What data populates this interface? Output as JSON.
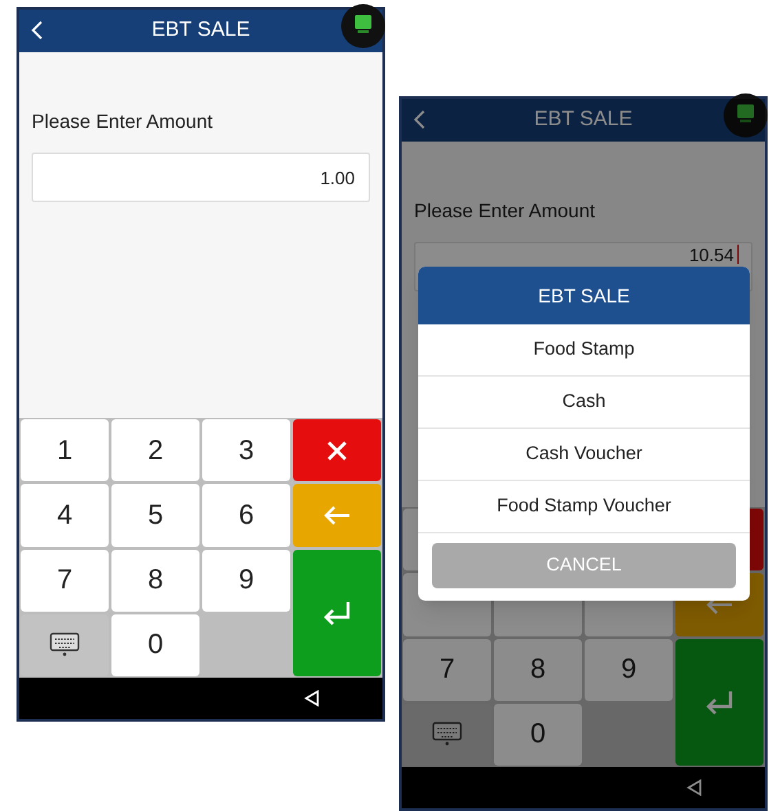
{
  "phones": [
    {
      "header": {
        "title": "EBT SALE"
      },
      "prompt": "Please Enter Amount",
      "amount": "1.00",
      "cursor": false,
      "dimmed": false,
      "keypad": [
        {
          "kind": "digit",
          "label": "1"
        },
        {
          "kind": "digit",
          "label": "2"
        },
        {
          "kind": "digit",
          "label": "3"
        },
        {
          "kind": "clear"
        },
        {
          "kind": "digit",
          "label": "4"
        },
        {
          "kind": "digit",
          "label": "5"
        },
        {
          "kind": "digit",
          "label": "6"
        },
        {
          "kind": "backspace"
        },
        {
          "kind": "digit",
          "label": "7"
        },
        {
          "kind": "digit",
          "label": "8"
        },
        {
          "kind": "digit",
          "label": "9"
        },
        {
          "kind": "enter"
        },
        {
          "kind": "keyboard"
        },
        {
          "kind": "digit",
          "label": "0"
        }
      ]
    },
    {
      "header": {
        "title": "EBT SALE"
      },
      "prompt": "Please Enter Amount",
      "amount": "10.54",
      "cursor": true,
      "dimmed": true,
      "keypad": [
        {
          "kind": "covered"
        },
        {
          "kind": "hidden"
        },
        {
          "kind": "hidden"
        },
        {
          "kind": "covered-clear"
        },
        {
          "kind": "covered"
        },
        {
          "kind": "covered"
        },
        {
          "kind": "covered"
        },
        {
          "kind": "backspace"
        },
        {
          "kind": "digit",
          "label": "7"
        },
        {
          "kind": "digit",
          "label": "8"
        },
        {
          "kind": "digit",
          "label": "9"
        },
        {
          "kind": "enter"
        },
        {
          "kind": "keyboard"
        },
        {
          "kind": "digit",
          "label": "0"
        }
      ],
      "dialog": {
        "title": "EBT SALE",
        "options": [
          "Food Stamp",
          "Cash",
          "Cash Voucher",
          "Food Stamp Voucher"
        ],
        "cancel": {
          "label": "CANCEL",
          "disabled": true
        }
      }
    }
  ]
}
